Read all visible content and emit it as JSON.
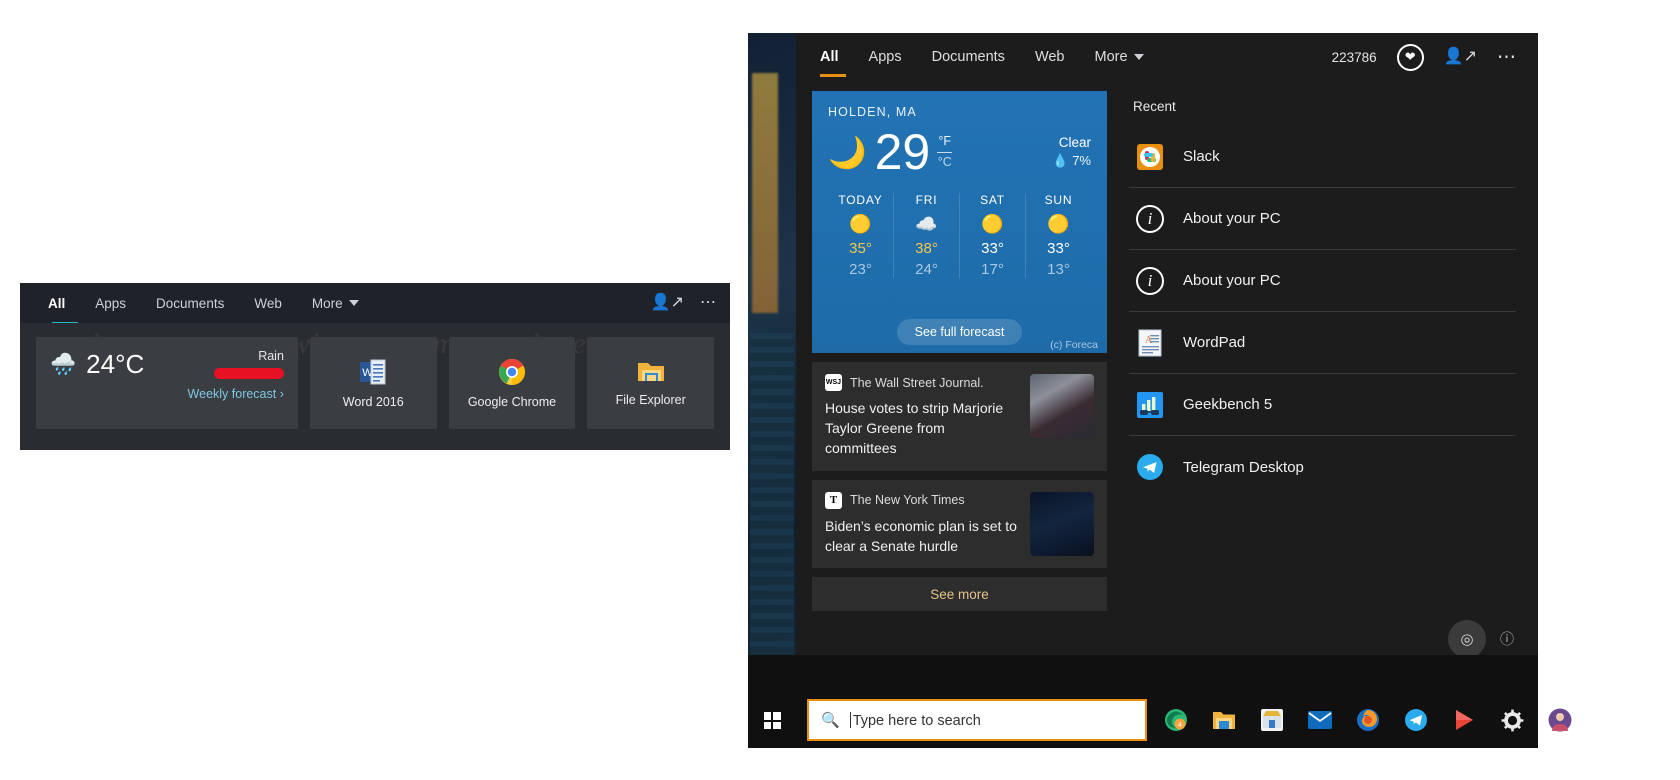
{
  "left_flyout": {
    "tabs": [
      {
        "label": "All",
        "active": true
      },
      {
        "label": "Apps",
        "active": false
      },
      {
        "label": "Documents",
        "active": false
      },
      {
        "label": "Web",
        "active": false
      },
      {
        "label": "More",
        "active": false
      }
    ],
    "icons": {
      "account": "person-share-icon",
      "overflow": "ellipsis-icon"
    },
    "watermark": "winaero.com",
    "weather": {
      "icon": "rain-cloud-icon",
      "temperature": "24°C",
      "condition": "Rain",
      "bar_color": "#e81123",
      "link": "Weekly forecast",
      "chevron": "›"
    },
    "tiles": [
      {
        "label": "Word 2016",
        "icon": "word-icon"
      },
      {
        "label": "Google Chrome",
        "icon": "chrome-icon"
      },
      {
        "label": "File Explorer",
        "icon": "folder-icon"
      }
    ]
  },
  "right_panel": {
    "tabs": [
      {
        "label": "All",
        "active": true
      },
      {
        "label": "Apps",
        "active": false
      },
      {
        "label": "Documents",
        "active": false
      },
      {
        "label": "Web",
        "active": false
      },
      {
        "label": "More",
        "active": false
      }
    ],
    "accent_color": "#e8900c",
    "points": "223786",
    "heart_icon": "heart-icon",
    "account_icon": "person-share-icon",
    "overflow_icon": "ellipsis-icon",
    "weather": {
      "city": "HOLDEN, MA",
      "icon": "crescent-moon-icon",
      "temperature": "29",
      "unit_primary": "°F",
      "unit_secondary": "°C",
      "condition": "Clear",
      "precipitation": "7%",
      "precip_icon": "water-drop-icon",
      "days": [
        {
          "day": "TODAY",
          "icon": "sun-icon",
          "high": "35°",
          "low": "23°",
          "high_style": "gold"
        },
        {
          "day": "FRI",
          "icon": "cloud-icon",
          "high": "38°",
          "low": "24°",
          "high_style": "gold"
        },
        {
          "day": "SAT",
          "icon": "sun-icon",
          "high": "33°",
          "low": "17°",
          "high_style": "white"
        },
        {
          "day": "SUN",
          "icon": "sun-icon",
          "high": "33°",
          "low": "13°",
          "high_style": "white"
        }
      ],
      "button": "See full forecast",
      "credit": "(c) Foreca"
    },
    "news": [
      {
        "source": "The Wall Street Journal.",
        "source_logo": "WSJ",
        "headline": "House votes to strip Marjorie Taylor Greene from committees",
        "thumb": "wsj-photo"
      },
      {
        "source": "The New York Times",
        "source_logo": "T",
        "headline": "Biden’s economic plan is set to clear a Senate hurdle",
        "thumb": "nyt-photo"
      }
    ],
    "see_more": "See more",
    "recent_title": "Recent",
    "recent_items": [
      {
        "label": "Slack",
        "icon": "slack-icon"
      },
      {
        "label": "About your PC",
        "icon": "info-circle-icon"
      },
      {
        "label": "About your PC",
        "icon": "info-circle-icon"
      },
      {
        "label": "WordPad",
        "icon": "wordpad-icon"
      },
      {
        "label": "Geekbench 5",
        "icon": "geekbench-icon"
      },
      {
        "label": "Telegram Desktop",
        "icon": "telegram-icon"
      }
    ],
    "corner": {
      "lens_icon": "visual-search-icon",
      "info_icon": "info-icon"
    }
  },
  "taskbar": {
    "start_icon": "windows-start-icon",
    "search_icon": "magnifier-icon",
    "search_placeholder": "Type here to search",
    "search_value": "",
    "border_color": "#e8900c",
    "icons": [
      {
        "name": "edge-dev-icon"
      },
      {
        "name": "file-explorer-icon"
      },
      {
        "name": "microsoft-store-icon"
      },
      {
        "name": "mail-icon"
      },
      {
        "name": "firefox-icon"
      },
      {
        "name": "telegram-icon"
      },
      {
        "name": "media-player-icon"
      },
      {
        "name": "settings-gear-icon"
      },
      {
        "name": "user-avatar-icon"
      }
    ]
  }
}
